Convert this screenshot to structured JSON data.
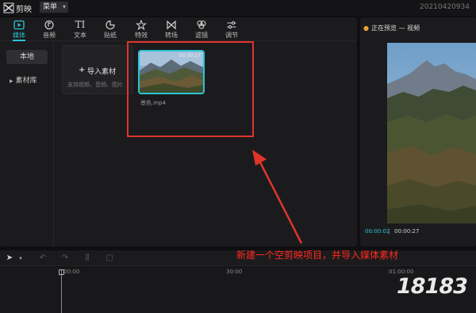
{
  "titlebar": {
    "app_name": "剪映",
    "menu_label": "菜单",
    "project_id": "20210420934"
  },
  "toolbar": {
    "tools": [
      {
        "label": "媒体",
        "icon": "media-icon"
      },
      {
        "label": "音频",
        "icon": "audio-icon"
      },
      {
        "label": "文本",
        "icon": "text-icon"
      },
      {
        "label": "贴纸",
        "icon": "sticker-icon"
      },
      {
        "label": "特效",
        "icon": "effects-icon"
      },
      {
        "label": "转场",
        "icon": "transition-icon"
      },
      {
        "label": "滤镜",
        "icon": "filter-icon"
      },
      {
        "label": "调节",
        "icon": "adjust-icon"
      }
    ],
    "text_glyph": "TI"
  },
  "sidebar": {
    "items": [
      {
        "label": "本地"
      },
      {
        "label": "素材库"
      }
    ]
  },
  "import": {
    "label": "导入素材",
    "hint": "支持视频、音频、图片"
  },
  "clip": {
    "name": "景色.mp4",
    "duration": "00:00:27"
  },
  "preview": {
    "title": "正在预览 — 视频",
    "current_time": "00:00:02",
    "separator": "|",
    "total_time": "00:00:27"
  },
  "timeline": {
    "ticks": [
      "00:00",
      "30:00",
      "01:00:00"
    ]
  },
  "annotation": {
    "text": "新建一个空剪映项目，并导入媒体素材"
  },
  "watermark": {
    "text": "18183"
  },
  "colors": {
    "accent": "#2cc3d6",
    "highlight": "#e0342b",
    "annotation": "#ff2a1f"
  }
}
